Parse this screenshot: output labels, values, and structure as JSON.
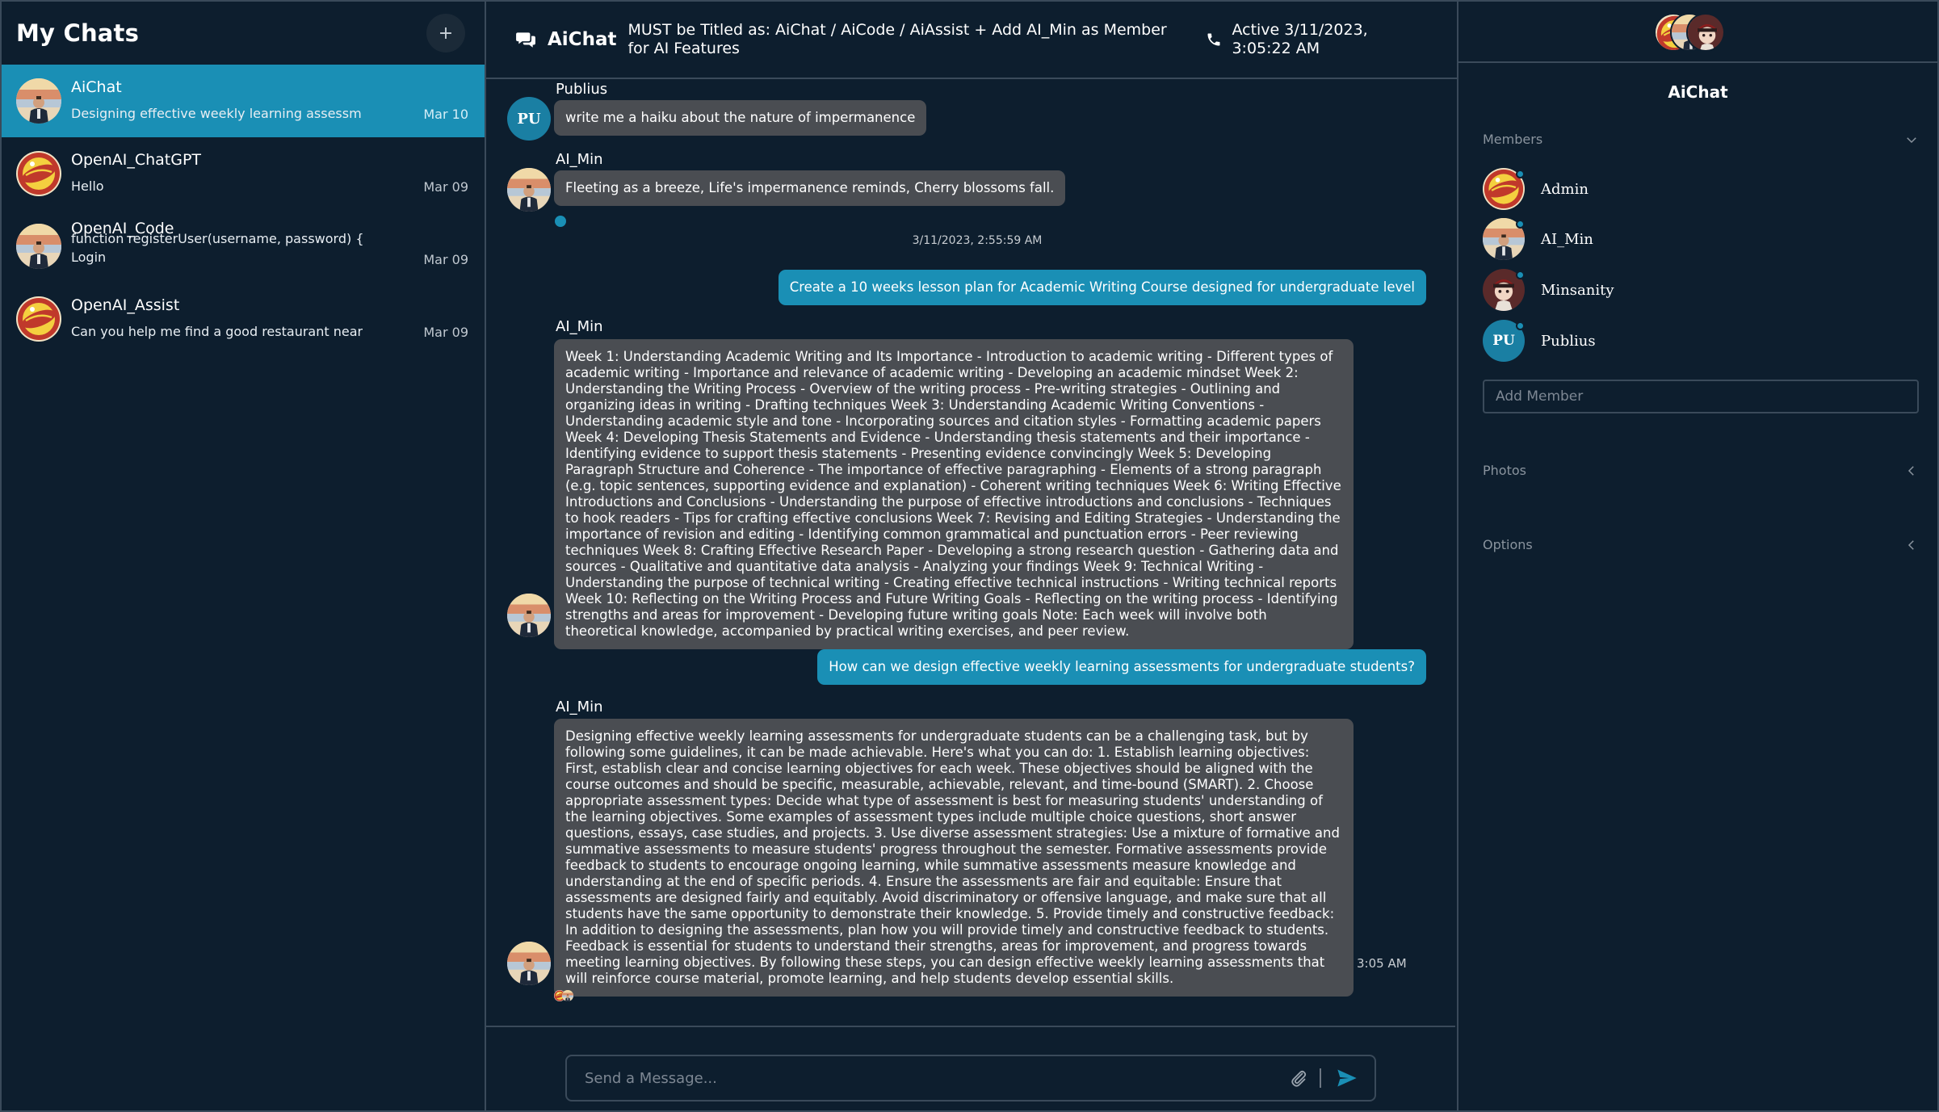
{
  "sidebar": {
    "title": "My Chats",
    "new_chat_icon": "plus",
    "chats": [
      {
        "name": "AiChat",
        "preview": "Designing effective weekly learning assessm",
        "date": "Mar 10",
        "avatar": "person-photo",
        "active": true
      },
      {
        "name": "OpenAI_ChatGPT",
        "preview": "Hello",
        "date": "Mar 09",
        "avatar": "logo-badge",
        "active": false
      },
      {
        "name": "OpenAI_Code",
        "preview_line1": "function registerUser(username, password) {",
        "preview": "Login",
        "date": "Mar 09",
        "avatar": "person-photo",
        "active": false
      },
      {
        "name": "OpenAI_Assist",
        "preview": "Can you help me find a good restaurant near",
        "date": "Mar 09",
        "avatar": "logo-badge",
        "active": false
      }
    ]
  },
  "header": {
    "title": "AiChat",
    "subtitle": "MUST be Titled as: AiChat / AiCode / AiAssist + Add AI_Min as Member for AI Features",
    "status": "Active 3/11/2023, 3:05:22 AM",
    "icons": [
      "chat-bubbles-icon",
      "phone-icon"
    ]
  },
  "messages": [
    {
      "sender": "Publius",
      "initials": "PU",
      "text": "write me a haiku about the nature of impermanence"
    },
    {
      "sender": "AI_Min",
      "text": "Fleeting as a breeze, Life's impermanence reminds, Cherry blossoms fall."
    },
    {
      "timestamp": "3/11/2023, 2:55:59 AM"
    },
    {
      "sender": "me",
      "text": "Create a 10 weeks lesson plan for Academic Writing Course designed for undergraduate level"
    },
    {
      "sender": "AI_Min",
      "text": "Week 1: Understanding Academic Writing and Its Importance - Introduction to academic writing - Different types of academic writing - Importance and relevance of academic writing - Developing an academic mindset Week 2: Understanding the Writing Process - Overview of the writing process - Pre-writing strategies - Outlining and organizing ideas in writing - Drafting techniques Week 3: Understanding Academic Writing Conventions - Understanding academic style and tone - Incorporating sources and citation styles - Formatting academic papers Week 4: Developing Thesis Statements and Evidence - Understanding thesis statements and their importance - Identifying evidence to support thesis statements - Presenting evidence convincingly Week 5: Developing Paragraph Structure and Coherence - The importance of effective paragraphing - Elements of a strong paragraph (e.g. topic sentences, supporting evidence and explanation) - Coherent writing techniques Week 6: Writing Effective Introductions and Conclusions - Understanding the purpose of effective introductions and conclusions - Techniques to hook readers - Tips for crafting effective conclusions Week 7: Revising and Editing Strategies - Understanding the importance of revision and editing - Identifying common grammatical and punctuation errors - Peer reviewing techniques Week 8: Crafting Effective Research Paper - Developing a strong research question - Gathering data and sources - Qualitative and quantitative data analysis - Analyzing your findings Week 9: Technical Writing - Understanding the purpose of technical writing - Creating effective technical instructions - Writing technical reports Week 10: Reflecting on the Writing Process and Future Writing Goals - Reflecting on the writing process - Identifying strengths and areas for improvement - Developing future writing goals Note: Each week will involve both theoretical knowledge, accompanied by practical writing exercises, and peer review."
    },
    {
      "sender": "me",
      "text": "How can we design effective weekly learning assessments for undergraduate students?"
    },
    {
      "sender": "AI_Min",
      "text": "Designing effective weekly learning assessments for undergraduate students can be a challenging task, but by following some guidelines, it can be made achievable. Here's what you can do: 1. Establish learning objectives: First, establish clear and concise learning objectives for each week. These objectives should be aligned with the course outcomes and should be specific, measurable, achievable, relevant, and time-bound (SMART). 2. Choose appropriate assessment types: Decide what type of assessment is best for measuring students' understanding of the learning objectives. Some examples of assessment types include multiple choice questions, short answer questions, essays, case studies, and projects. 3. Use diverse assessment strategies: Use a mixture of formative and summative assessments to measure students' progress throughout the semester. Formative assessments provide feedback to students to encourage ongoing learning, while summative assessments measure knowledge and understanding at the end of specific periods. 4. Ensure the assessments are fair and equitable: Ensure that assessments are designed fairly and equitably. Avoid discriminatory or offensive language, and make sure that all students have the same opportunity to demonstrate their knowledge. 5. Provide timely and constructive feedback: In addition to designing the assessments, plan how you will provide timely and constructive feedback to students. Feedback is essential for students to understand their strengths, areas for improvement, and progress towards meeting learning objectives. By following these steps, you can design effective weekly learning assessments that will reinforce course material, promote learning, and help students develop essential skills.",
      "time": "3:05 AM"
    }
  ],
  "composer": {
    "placeholder": "Send a Message...",
    "icons": [
      "paperclip-icon",
      "send-icon"
    ]
  },
  "right_panel": {
    "title": "AiChat",
    "members_label": "Members",
    "members": [
      {
        "name": "Admin",
        "avatar": "logo-badge"
      },
      {
        "name": "AI_Min",
        "avatar": "person-photo"
      },
      {
        "name": "Minsanity",
        "avatar": "character-illustration"
      },
      {
        "name": "Publius",
        "avatar": "initials",
        "initials": "PU"
      }
    ],
    "add_member_placeholder": "Add Member",
    "photos_label": "Photos",
    "options_label": "Options"
  },
  "colors": {
    "background": "#0d1e2e",
    "accent": "#1a8fb5",
    "bubble": "#4a4d52",
    "border": "#3a4a5a"
  }
}
